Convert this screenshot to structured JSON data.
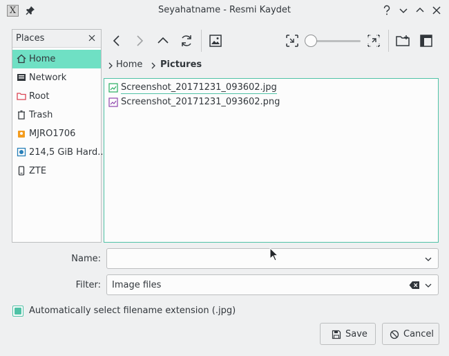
{
  "window": {
    "title": "Seyahatname - Resmi Kaydet",
    "app_icon_glyph": "X"
  },
  "places": {
    "title": "Places",
    "items": [
      {
        "label": "Home",
        "icon": "home-icon",
        "selected": true
      },
      {
        "label": "Network",
        "icon": "network-icon"
      },
      {
        "label": "Root",
        "icon": "root-folder-icon"
      },
      {
        "label": "Trash",
        "icon": "trash-icon"
      },
      {
        "label": "MJRO1706",
        "icon": "user-drive-icon"
      },
      {
        "label": "214,5 GiB Hard...",
        "icon": "hard-drive-icon"
      },
      {
        "label": "ZTE",
        "icon": "phone-icon"
      }
    ]
  },
  "breadcrumb": {
    "items": [
      "Home",
      "Pictures"
    ]
  },
  "files": [
    {
      "name": "Screenshot_20171231_093602.jpg",
      "icon": "image-file-icon",
      "icon_color": "#27ae60"
    },
    {
      "name": "Screenshot_20171231_093602.png",
      "icon": "image-file-icon",
      "icon_color": "#8e44ad"
    }
  ],
  "form": {
    "name_label": "Name:",
    "name_value": "",
    "filter_label": "Filter:",
    "filter_value": "Image files",
    "auto_extension_label": "Automatically select filename extension (.jpg)",
    "auto_extension_checked": true
  },
  "buttons": {
    "save": "Save",
    "cancel": "Cancel"
  },
  "colors": {
    "accent": "#4fc2a6",
    "selection": "#6fe0c4"
  }
}
